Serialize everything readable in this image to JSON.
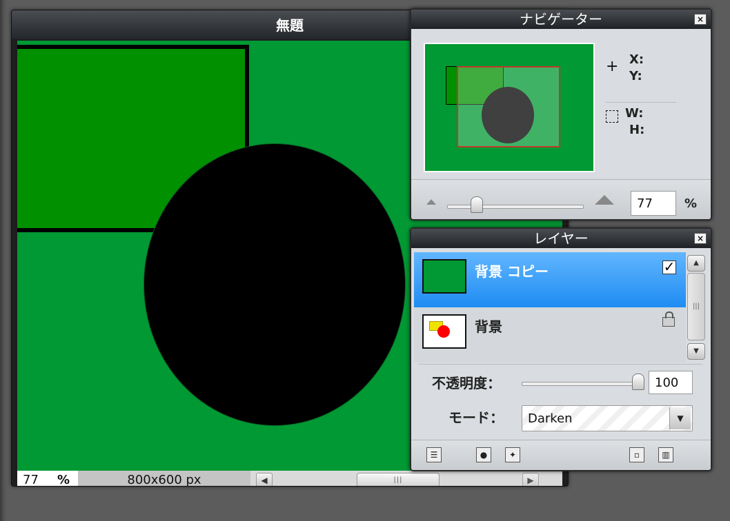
{
  "image_window": {
    "title": "無題",
    "zoom_value": "77",
    "zoom_unit": "%",
    "size": "800x600 px"
  },
  "navigator": {
    "title": "ナビゲーター",
    "x_label": "X:",
    "y_label": "Y:",
    "w_label": "W:",
    "h_label": "H:",
    "zoom_value": "77",
    "zoom_unit": "%"
  },
  "layers": {
    "title": "レイヤー",
    "items": [
      {
        "name": "背景 コピー",
        "selected": true,
        "visible": true
      },
      {
        "name": "背景",
        "selected": false,
        "locked": true
      }
    ],
    "opacity_label": "不透明度：",
    "opacity_value": "100",
    "mode_label": "モード：",
    "mode_value": "Darken"
  },
  "colors": {
    "canvas_green": "#009933",
    "rect_green": "#009000",
    "selection_blue": "#1e8cf2"
  },
  "icons": {
    "close": "×",
    "check": "✓",
    "arrow_left": "◀",
    "arrow_right": "▶",
    "arrow_up": "▲",
    "arrow_down": "▼",
    "grip": "|||",
    "dropdown": "▼"
  }
}
